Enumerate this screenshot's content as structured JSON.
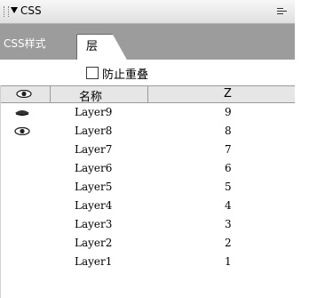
{
  "panel": {
    "title": "CSS",
    "tabs": [
      "CSS样式",
      "层"
    ],
    "active_tab_index": 1,
    "option_label": "防止重叠",
    "option_checked": false,
    "columns": {
      "name": "名称",
      "z": "Z"
    },
    "icons": {
      "header_eye": "eye-icon",
      "eye_closed": "eye-closed-icon",
      "eye_open": "eye-open-icon"
    },
    "rows": [
      {
        "name": "Layer9",
        "z": "9",
        "visibility": "closed"
      },
      {
        "name": "Layer8",
        "z": "8",
        "visibility": "open"
      },
      {
        "name": "Layer7",
        "z": "7",
        "visibility": ""
      },
      {
        "name": "Layer6",
        "z": "6",
        "visibility": ""
      },
      {
        "name": "Layer5",
        "z": "5",
        "visibility": ""
      },
      {
        "name": "Layer4",
        "z": "4",
        "visibility": ""
      },
      {
        "name": "Layer3",
        "z": "3",
        "visibility": ""
      },
      {
        "name": "Layer2",
        "z": "2",
        "visibility": ""
      },
      {
        "name": "Layer1",
        "z": "1",
        "visibility": ""
      }
    ]
  }
}
